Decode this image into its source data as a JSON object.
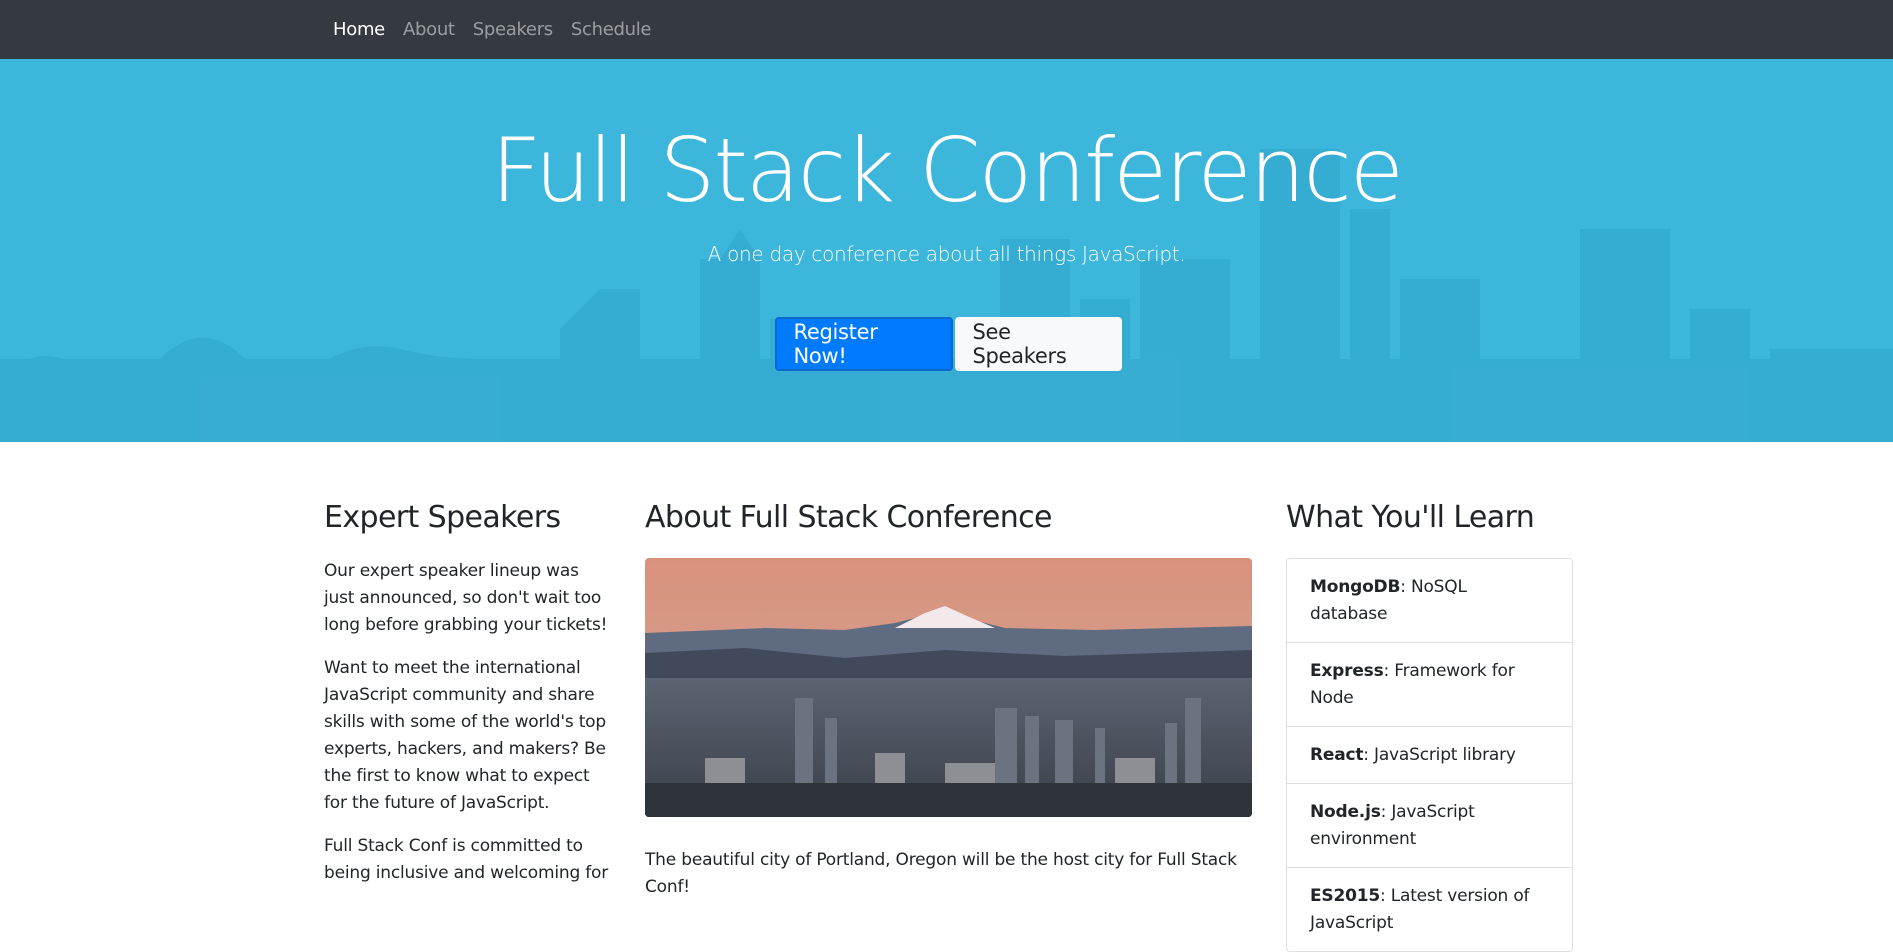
{
  "nav": {
    "items": [
      {
        "label": "Home",
        "active": true
      },
      {
        "label": "About",
        "active": false
      },
      {
        "label": "Speakers",
        "active": false
      },
      {
        "label": "Schedule",
        "active": false
      }
    ]
  },
  "hero": {
    "title": "Full Stack Conference",
    "subtitle": "A one day conference about all things JavaScript.",
    "register_label": "Register Now!",
    "speakers_label": "See Speakers",
    "bg_color": "#3db6dc"
  },
  "speakers_section": {
    "heading": "Expert Speakers",
    "paragraphs": [
      "Our expert speaker lineup was just announced, so don't wait too long before grabbing your tickets!",
      "Want to meet the international JavaScript community and share skills with some of the world's top experts, hackers, and makers? Be the first to know what to expect for the future of JavaScript.",
      "Full Stack Conf is committed to being inclusive and welcoming for"
    ]
  },
  "about_section": {
    "heading": "About Full Stack Conference",
    "body": "The beautiful city of Portland, Oregon will be the host city for Full Stack Conf!"
  },
  "learn_section": {
    "heading": "What You'll Learn",
    "items": [
      {
        "term": "MongoDB",
        "desc": ": NoSQL database"
      },
      {
        "term": "Express",
        "desc": ": Framework for Node"
      },
      {
        "term": "React",
        "desc": ": JavaScript library"
      },
      {
        "term": "Node.js",
        "desc": ": JavaScript environment"
      },
      {
        "term": "ES2015",
        "desc": ": Latest version of JavaScript"
      }
    ]
  },
  "colors": {
    "navbar": "#343a40",
    "primary": "#007bff",
    "light": "#f8f9fa"
  }
}
